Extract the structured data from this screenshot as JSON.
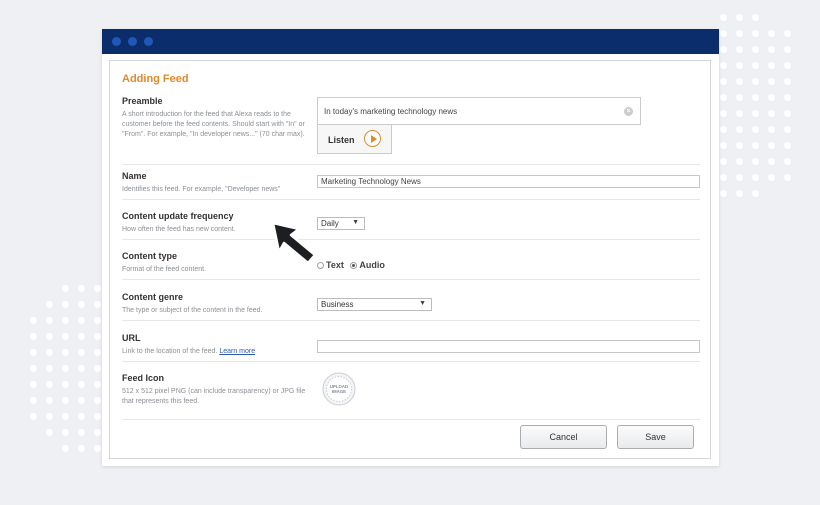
{
  "panel": {
    "title": "Adding Feed"
  },
  "preamble": {
    "label": "Preamble",
    "description": "A short introduction for the feed that Alexa reads to the customer before the feed contents. Should start with \"In\" or \"From\". For example, \"In developer news...\" (70 char max).",
    "value": "In today's marketing technology news",
    "listen_label": "Listen"
  },
  "name": {
    "label": "Name",
    "description": "Identifies this feed. For example, \"Developer news\"",
    "value": "Marketing Technology News"
  },
  "frequency": {
    "label": "Content update frequency",
    "description": "How often the feed has new content.",
    "selected": "Daily"
  },
  "content_type": {
    "label": "Content type",
    "description": "Format of the feed content.",
    "options": [
      "Text",
      "Audio"
    ],
    "selected": "Audio"
  },
  "genre": {
    "label": "Content genre",
    "description": "The type or subject of the content in the feed.",
    "selected": "Business"
  },
  "url": {
    "label": "URL",
    "description": "Link to the location of the feed.",
    "link_text": "Learn more",
    "value": ""
  },
  "feed_icon": {
    "label": "Feed Icon",
    "description": "512 x 512 pixel PNG (can include transparency) or JPG file that represents this feed.",
    "upload_line1": "UPLOAD",
    "upload_line2": "IMAGE"
  },
  "actions": {
    "cancel": "Cancel",
    "save": "Save"
  },
  "colors": {
    "titlebar": "#0b2d6b",
    "accent": "#e08a2c",
    "link": "#2a5ab0"
  },
  "icons": {
    "clear": "clear-circle-icon",
    "play": "play-icon",
    "cursor": "mouse-pointer-icon"
  }
}
